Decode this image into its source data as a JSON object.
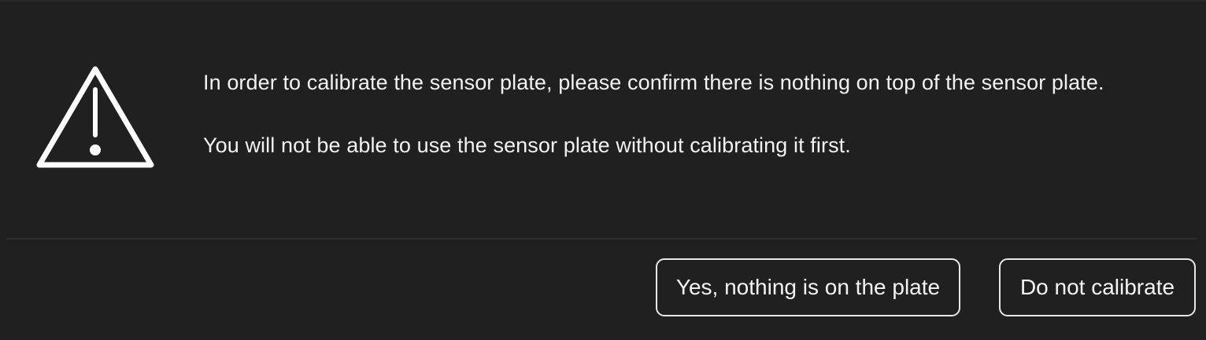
{
  "dialog": {
    "icon": "warning-triangle-icon",
    "message_lines": [
      "In order to calibrate the sensor plate, please confirm there is nothing on top of the sensor plate.",
      "You will not be able to use the sensor plate without calibrating it first."
    ],
    "buttons": {
      "confirm_label": "Yes, nothing is on the plate",
      "cancel_label": "Do not calibrate"
    },
    "colors": {
      "background": "#202020",
      "text": "#f2f2f2",
      "border": "#e8e8e8"
    }
  }
}
